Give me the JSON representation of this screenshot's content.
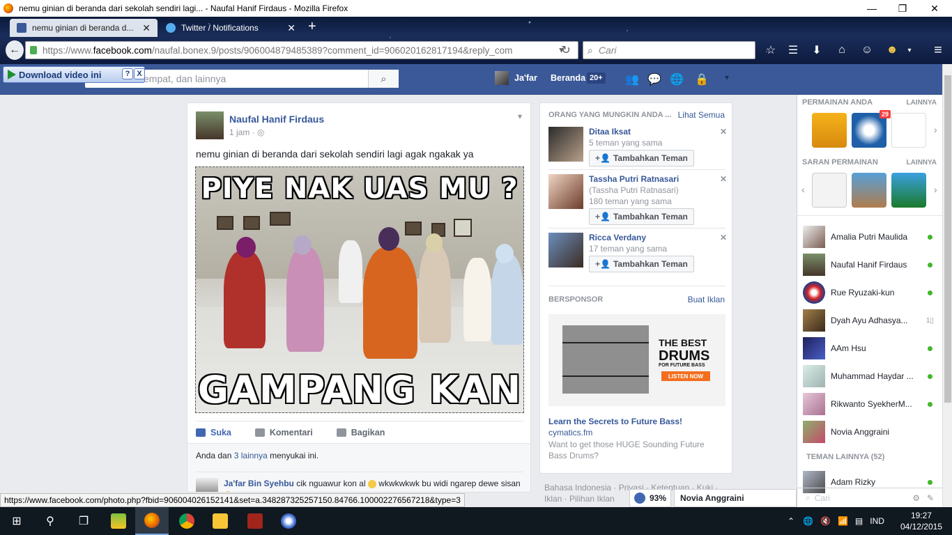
{
  "browser": {
    "window_title": "nemu ginian di beranda dari sekolah sendiri lagi... - Naufal Hanif Firdaus - Mozilla Firefox",
    "tabs": [
      {
        "label": "nemu ginian di beranda d...",
        "active": true
      },
      {
        "label": "Twitter / Notifications",
        "active": false
      }
    ],
    "url_prefix": "https://www.",
    "url_domain": "facebook.com",
    "url_rest": "/naufal.bonex.9/posts/906004879485389?comment_id=906020162817194&reply_com",
    "search_placeholder": "Cari",
    "status_url": "https://www.facebook.com/photo.php?fbid=906004026152141&set=a.348287325257150.84766.100002276567218&type=3"
  },
  "extension": {
    "download_label": "Download video ini",
    "help": "?",
    "close": "X"
  },
  "fb_header": {
    "search_placeholder": "empat, dan lainnya",
    "user_name": "Ja'far",
    "home_label": "Beranda",
    "home_count": "20+"
  },
  "post": {
    "author": "Naufal Hanif Firdaus",
    "time": "1 jam",
    "dot": "·",
    "text": "nemu ginian di beranda dari sekolah sendiri lagi agak ngakak ya",
    "meme_top": "PIYE NAK UAS MU ?",
    "meme_bottom": "GAMPANG KAN ?",
    "actions": {
      "like": "Suka",
      "comment": "Komentari",
      "share": "Bagikan"
    },
    "likes_prefix": "Anda dan ",
    "likes_link": "3 lainnya",
    "likes_suffix": " menyukai ini.",
    "comment": {
      "author": "Ja'far Bin Syehbu",
      "text_a": " cik nguawur kon al ",
      "text_b": " wkwkwkwk bu widi ngarep dewe sisan "
    }
  },
  "suggestions": {
    "header": "ORANG YANG MUNGKIN ANDA ...",
    "see_all": "Lihat Semua",
    "add_label": "Tambahkan Teman",
    "people": [
      {
        "name": "Ditaa Iksat",
        "lines": [
          "5 teman yang sama"
        ]
      },
      {
        "name": "Tassha Putri Ratnasari",
        "lines": [
          "(Tassha Putri Ratnasari)",
          "180 teman yang sama"
        ]
      },
      {
        "name": "Ricca Verdany",
        "lines": [
          "17 teman yang sama"
        ]
      }
    ],
    "sponsored": "BERSPONSOR",
    "create_ad": "Buat Iklan",
    "ad": {
      "img_line1": "THE BEST",
      "img_line2": "DRUMS",
      "img_line3": "FOR FUTURE BASS",
      "img_button": "LISTEN NOW",
      "headline": "Learn the Secrets to Future Bass!",
      "domain": "cymatics.fm",
      "description": "Want to get those HUGE Sounding Future Bass Drums?"
    }
  },
  "footer_links": "Bahasa Indonesia · Privasi · Ketentuan · Kuki · Iklan · Pilihan Iklan",
  "chat": {
    "count": "93%",
    "open_chat": "Novia Anggraini"
  },
  "sidebar": {
    "games_header": "PERMAINAN ANDA",
    "games_more": "LAINNYA",
    "game_badge": "29",
    "suggested_header": "SARAN PERMAINAN",
    "suggested_more": "LAINNYA",
    "contacts": [
      {
        "name": "Amalia Putri Maulida",
        "status": "online"
      },
      {
        "name": "Naufal Hanif Firdaus",
        "status": "online"
      },
      {
        "name": "Rue Ryuzaki-kun",
        "status": "online"
      },
      {
        "name": "Dyah Ayu Adhasya...",
        "status": "mobile",
        "mobile_label": "1▯"
      },
      {
        "name": "AAm Hsu",
        "status": "online"
      },
      {
        "name": "Muhammad Haydar ...",
        "status": "online"
      },
      {
        "name": "Rikwanto SyekherM...",
        "status": "online"
      },
      {
        "name": "Novia Anggraini",
        "status": "none"
      }
    ],
    "other_friends_header": "TEMAN LAINNYA (52)",
    "other_contact": {
      "name": "Adam Rizky",
      "status": "online"
    },
    "search_placeholder": "Cari"
  },
  "taskbar": {
    "lang": "IND",
    "time": "19:27",
    "date": "04/12/2015"
  },
  "colors": {
    "fb_blue": "#3b5998",
    "link": "#365899",
    "online": "#42b72a"
  }
}
